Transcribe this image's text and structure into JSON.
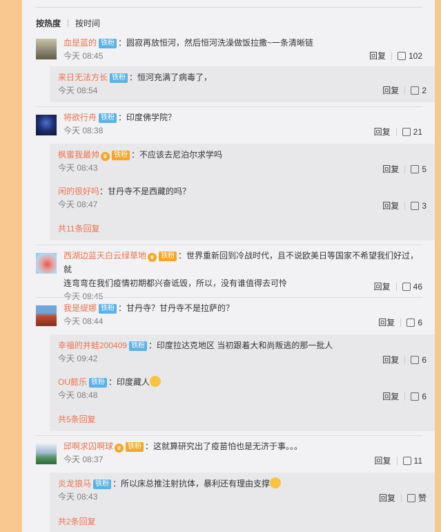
{
  "sort": {
    "hot": "按热度",
    "time": "按时间"
  },
  "comments": [
    {
      "user": "血是蓝的",
      "badge": "铁粉",
      "text": "：圆寂再放恒河，然后恒河洗澡做饭拉撒~一条清晰链",
      "time": "今天 08:45",
      "reply": "回复",
      "likes": "102",
      "replies": [
        {
          "user": "来日无法方长",
          "badge": "铁粉",
          "text": "：恒河充满了病毒了，",
          "time": "今天 08:54",
          "reply": "回复",
          "likes": "2"
        }
      ]
    },
    {
      "user": "将欲行舟",
      "badge": "铁粉",
      "text": "：印度佛学院？",
      "time": "今天 08:38",
      "reply": "回复",
      "likes": "21",
      "replies": [
        {
          "user": "枫蜜我最帅",
          "badge": "铁粉",
          "text": "：不应该去尼泊尔求学吗",
          "time": "今天 08:43",
          "reply": "回复",
          "likes": "5"
        },
        {
          "user": "闲的很好吗",
          "text": "：甘丹寺不是西藏的吗？",
          "time": "今天 08:47",
          "reply": "回复",
          "likes": "3"
        }
      ],
      "more": "共11条回复"
    },
    {
      "user": "西湖边蓝天白云绿草地",
      "badge": "铁粉",
      "text": "：世界重新回到冷战时代，且不说欧美日等国家不希望我们好过，就连弯弯在我们疫情初期都兴奋诋毁，所以，没有谁值得去可怜",
      "text1": "：世界重新回到冷战时代，且不说欧美日等国家不希望我们好过，就",
      "text2": "连弯弯在我们疫情初期都兴奋诋毁，所以，没有谁值得去可怜",
      "time": "今天 08:45",
      "reply": "回复",
      "likes": "46"
    },
    {
      "user": "我是缇娜",
      "badge": "铁粉",
      "text": "：甘丹寺？甘丹寺不是拉萨的？",
      "time": "今天 08:44",
      "reply": "回复",
      "likes": "6",
      "replies": [
        {
          "user": "幸福的井蛙200409",
          "badge": "铁粉",
          "text": "：印度拉达克地区  当初跟着大和尚叛逃的那一批人",
          "time": "今天 09:42",
          "reply": "回复",
          "likes": "6"
        },
        {
          "user": "OU懿乐",
          "badge": "铁粉",
          "text": "：印度藏人",
          "time": "今天 08:48",
          "reply": "回复",
          "likes": "6"
        }
      ],
      "more": "共5条回复"
    },
    {
      "user": "邱啊求囚啊球",
      "badge": "铁粉",
      "text": "：这就算研究出了疫苗怕也是无济于事。。。",
      "time": "今天 08:37",
      "reply": "回复",
      "likes": "11",
      "replies": [
        {
          "user": "炎龙狼马",
          "badge": "铁粉",
          "text": "：所以床总推注射抗体，暴利还有理由支撑",
          "time": "今天 08:43",
          "reply": "回复",
          "likes": "赞"
        }
      ],
      "more": "共2条回复"
    }
  ],
  "colors": {
    "link": "#eb7350",
    "badge": "#5ab2e8",
    "panel": "#f2f2f5",
    "sub": "#e8e8eb",
    "outer": "#f8c890"
  }
}
